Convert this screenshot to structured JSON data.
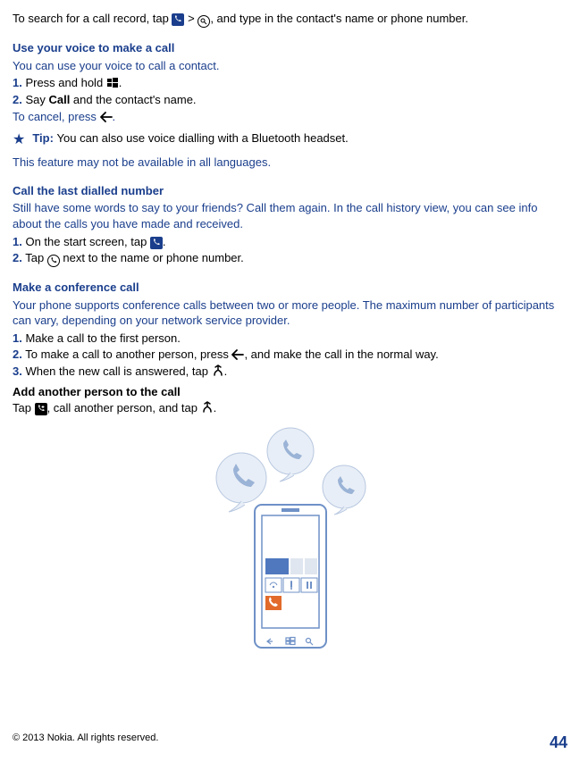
{
  "intro": {
    "search_pre": "To search for a call record, tap ",
    "search_mid": " > ",
    "search_post": ", and type in the contact's name or phone number."
  },
  "voice": {
    "heading": "Use your voice to make a call",
    "desc": "You can use your voice to call a contact.",
    "step1_num": "1.",
    "step1_pre": " Press and hold ",
    "step1_post": ".",
    "step2_num": "2.",
    "step2_pre": " Say ",
    "step2_bold": "Call",
    "step2_post": " and the contact's name.",
    "cancel_pre": "To cancel, press ",
    "cancel_post": ".",
    "tip_label": "Tip: ",
    "tip_text": "You can also use voice dialling with a Bluetooth headset.",
    "note": "This feature may not be available in all languages."
  },
  "last": {
    "heading": "Call the last dialled number",
    "desc": "Still have some words to say to your friends? Call them again. In the call history view, you can see info about the calls you have made and received.",
    "step1_num": "1.",
    "step1_pre": " On the start screen, tap ",
    "step1_post": ".",
    "step2_num": "2.",
    "step2_pre": " Tap ",
    "step2_post": " next to the name or phone number."
  },
  "conf": {
    "heading": "Make a conference call",
    "desc": "Your phone supports conference calls between two or more people. The maximum number of participants can vary, depending on your network service provider.",
    "step1_num": "1.",
    "step1_text": " Make a call to the first person.",
    "step2_num": "2.",
    "step2_pre": " To make a call to another person, press ",
    "step2_post": ", and make the call in the normal way.",
    "step3_num": "3.",
    "step3_pre": " When the new call is answered, tap ",
    "step3_post": "."
  },
  "add": {
    "heading": "Add another person to the call",
    "pre": "Tap ",
    "mid": ", call another person, and tap ",
    "post": "."
  },
  "footer": {
    "copyright": "© 2013 Nokia. All rights reserved.",
    "page": "44"
  }
}
